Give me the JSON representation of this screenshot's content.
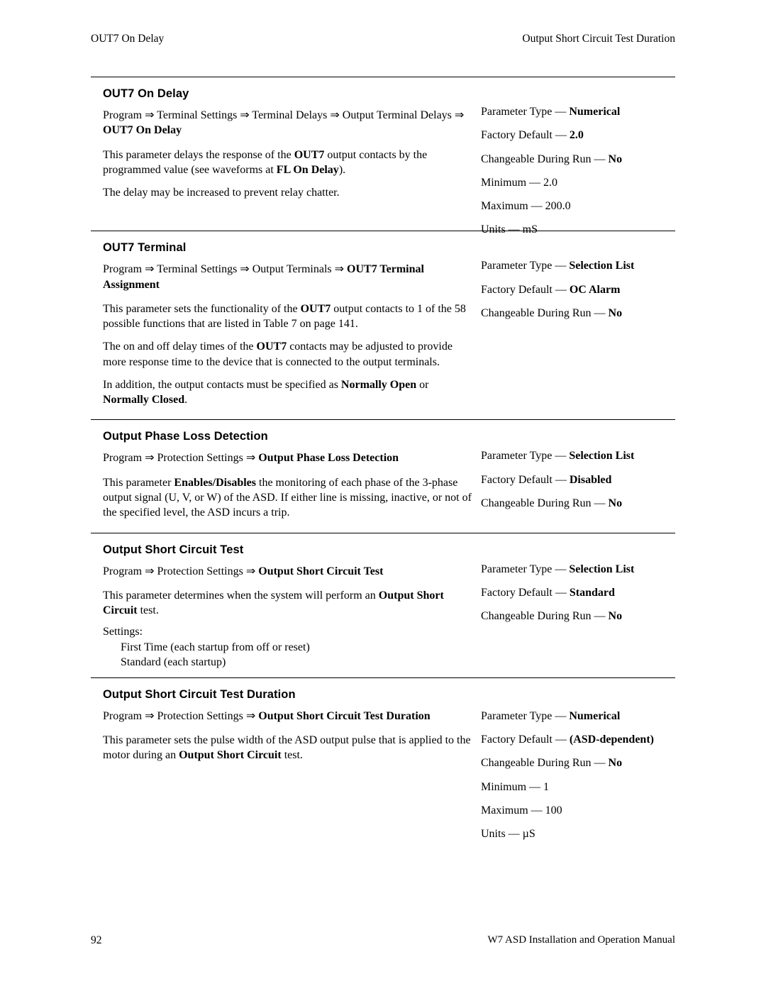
{
  "header": {
    "left": "OUT7 On Delay",
    "right": "Output Short Circuit Test Duration"
  },
  "footer": {
    "page_number": "92",
    "manual_title": "W7 ASD Installation and Operation Manual"
  },
  "sections": [
    {
      "title": "OUT7 On Delay",
      "path_prefix": "Program ⇒ Terminal Settings ⇒ Terminal Delays ⇒ Output Terminal Delays ⇒ ",
      "path_bold": "OUT7 On Delay",
      "paragraphs": [
        "This parameter delays the response of the OUT7 output contacts by the programmed value (see waveforms at FL On Delay).",
        "The delay may be increased to prevent relay chatter."
      ],
      "attributes": [
        {
          "label": "Parameter Type — ",
          "value": "Numerical"
        },
        {
          "label": "Factory Default — ",
          "value": "2.0"
        },
        {
          "label": "Changeable During Run — ",
          "value": "No"
        },
        {
          "label": "Minimum — 2.0",
          "value": ""
        },
        {
          "label": "Maximum — 200.0",
          "value": ""
        },
        {
          "label": "Units — mS",
          "value": ""
        }
      ]
    },
    {
      "title": "OUT7 Terminal",
      "path_prefix": "Program ⇒ Terminal Settings ⇒ Output Terminals ⇒ ",
      "path_bold": "OUT7 Terminal Assignment",
      "paragraphs": [
        "This parameter sets the functionality of the OUT7 output contacts to 1 of the 58 possible functions that are listed in Table 7 on page 141.",
        "The on and off delay times of the OUT7 contacts may be adjusted to provide more response time to the device that is connected to the output terminals.",
        "In addition, the output contacts must be specified as Normally Open or Normally Closed."
      ],
      "attributes": [
        {
          "label": "Parameter Type — ",
          "value": "Selection List"
        },
        {
          "label": "Factory Default — ",
          "value": "OC Alarm"
        },
        {
          "label": "Changeable During Run — ",
          "value": "No"
        }
      ]
    },
    {
      "title": "Output Phase Loss Detection",
      "path_prefix": "Program ⇒ Protection Settings ⇒ ",
      "path_bold": "Output Phase Loss Detection",
      "paragraphs": [
        "This parameter Enables/Disables the monitoring of each phase of the 3-phase output signal (U, V, or W) of the ASD. If either line is missing, inactive, or not of the specified level, the ASD incurs a trip."
      ],
      "attributes": [
        {
          "label": "Parameter Type — ",
          "value": "Selection List"
        },
        {
          "label": "Factory Default — ",
          "value": "Disabled"
        },
        {
          "label": "Changeable During Run — ",
          "value": "No"
        }
      ]
    },
    {
      "title": "Output Short Circuit Test",
      "path_prefix": "Program ⇒ Protection Settings ⇒ ",
      "path_bold": "Output Short Circuit Test",
      "paragraphs": [
        "This parameter determines when the system will perform an Output Short Circuit test."
      ],
      "settings_label": "Settings:",
      "settings": [
        "First Time (each startup from off or reset)",
        "Standard (each startup)"
      ],
      "attributes": [
        {
          "label": "Parameter Type — ",
          "value": "Selection List"
        },
        {
          "label": "Factory Default — ",
          "value": "Standard"
        },
        {
          "label": "Changeable During Run — ",
          "value": "No"
        }
      ]
    },
    {
      "title": "Output Short Circuit Test Duration",
      "path_prefix": "Program ⇒ Protection Settings ⇒ ",
      "path_bold": "Output Short Circuit Test Duration",
      "paragraphs": [
        "This parameter sets the pulse width of the ASD output pulse that is applied to the motor during an Output Short Circuit test."
      ],
      "attributes": [
        {
          "label": "Parameter Type — ",
          "value": "Numerical"
        },
        {
          "label": "Factory Default — ",
          "value": "(ASD-dependent)"
        },
        {
          "label": "Changeable During Run — ",
          "value": "No"
        },
        {
          "label": "Minimum — 1",
          "value": ""
        },
        {
          "label": "Maximum — 100",
          "value": ""
        },
        {
          "label": "Units — µS",
          "value": ""
        }
      ]
    }
  ]
}
